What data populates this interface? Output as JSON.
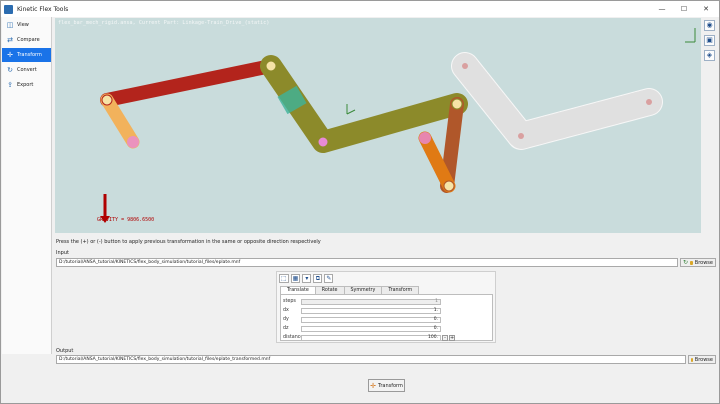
{
  "window": {
    "title": "Kinetic Flex Tools",
    "controls": [
      "—",
      "☐",
      "✕"
    ]
  },
  "sidebar": {
    "items": [
      {
        "label": "View",
        "icon": "camera-icon"
      },
      {
        "label": "Compare",
        "icon": "compare-icon"
      },
      {
        "label": "Transform",
        "icon": "transform-icon"
      },
      {
        "label": "Convert",
        "icon": "convert-icon"
      },
      {
        "label": "Export",
        "icon": "export-icon"
      }
    ],
    "active_index": 2
  },
  "viewport": {
    "header": "flex_bar_mech_rigid.ansa,  Current Part: Linkage-Train_Drive_(static)",
    "gravity": "GRAVITY = 9806.6500",
    "background": "#c9dcdc"
  },
  "hint": "Press the (+) or (-) button to apply previous transformation in the same or opposite direction respectively",
  "input": {
    "label": "Input",
    "path": "D:/tutorial/ANSA_tutorial/KINETICS/flex_body_simulation/tutorial_files/eplate.mnf",
    "browse_label": "Browse"
  },
  "panel": {
    "tabs": [
      "Translate",
      "Rotate",
      "Symmetry",
      "Transform"
    ],
    "active_tab": 0,
    "fields": [
      {
        "label": "steps",
        "value": "1",
        "disabled": true
      },
      {
        "label": "dx",
        "value": "1."
      },
      {
        "label": "dy",
        "value": "0."
      },
      {
        "label": "dz",
        "value": "0."
      },
      {
        "label": "distance",
        "value": "100."
      }
    ]
  },
  "output": {
    "label": "Output",
    "path": "D:/tutorial/ANSA_tutorial/KINETICS/flex_body_simulation/tutorial_files/eplate_transformed.mnf",
    "browse_label": "Browse"
  },
  "transform_button": "Transform"
}
